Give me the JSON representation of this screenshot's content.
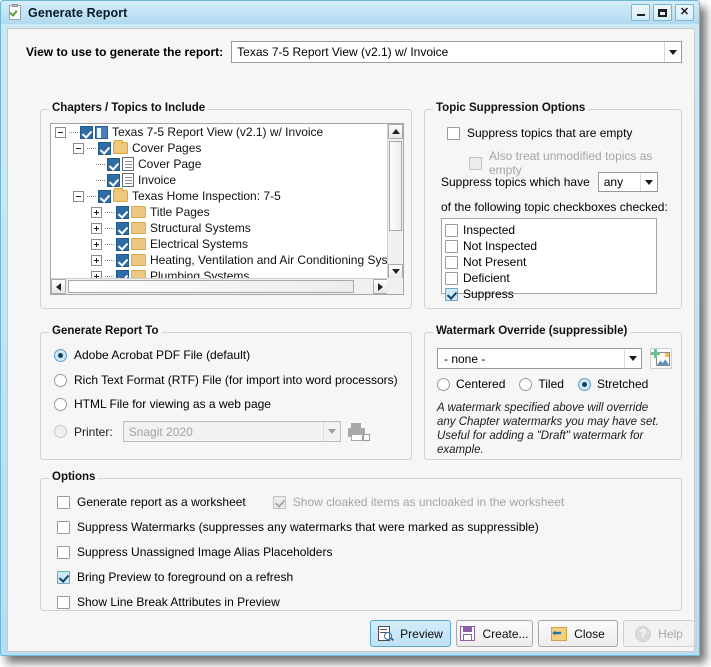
{
  "window": {
    "title": "Generate Report",
    "icon": "clipboard-check-icon",
    "minimize_label": "",
    "maximize_label": "",
    "close_label": "✕"
  },
  "view_row": {
    "label": "View to use to generate the report:",
    "value": "Texas 7-5 Report View (v2.1) w/ Invoice"
  },
  "chapters": {
    "title": "Chapters / Topics to Include",
    "tree": [
      {
        "label": "Texas 7-5 Report View (v2.1) w/ Invoice",
        "depth": 0,
        "expander": "minus",
        "icon": "view-icon",
        "checked": true
      },
      {
        "label": "Cover Pages",
        "depth": 1,
        "expander": "minus",
        "icon": "folder-open-icon",
        "checked": true
      },
      {
        "label": "Cover Page",
        "depth": 2,
        "expander": "none",
        "icon": "document-icon",
        "checked": true
      },
      {
        "label": "Invoice",
        "depth": 2,
        "expander": "none",
        "icon": "document-icon",
        "checked": true
      },
      {
        "label": "Texas Home Inspection: 7-5",
        "depth": 1,
        "expander": "minus",
        "icon": "folder-open-icon",
        "checked": true
      },
      {
        "label": "Title Pages",
        "depth": 2,
        "expander": "plus",
        "icon": "folder-icon",
        "checked": true
      },
      {
        "label": "Structural Systems",
        "depth": 2,
        "expander": "plus",
        "icon": "folder-icon",
        "checked": true
      },
      {
        "label": "Electrical Systems",
        "depth": 2,
        "expander": "plus",
        "icon": "folder-icon",
        "checked": true
      },
      {
        "label": "Heating, Ventilation and Air Conditioning Syste",
        "depth": 2,
        "expander": "plus",
        "icon": "folder-icon",
        "checked": true
      },
      {
        "label": "Plumbing Systems",
        "depth": 2,
        "expander": "plus",
        "icon": "folder-icon",
        "checked": true
      }
    ]
  },
  "suppression": {
    "title": "Topic Suppression Options",
    "suppress_empty_label": "Suppress topics that are empty",
    "suppress_empty_checked": false,
    "unmodified_label": "Also treat unmodified topics as empty",
    "unmodified_checked": false,
    "unmodified_disabled": true,
    "which_have_label": "Suppress topics which have",
    "which_have_value": "any",
    "following_label": "of the following topic checkboxes checked:",
    "checkbox_list": [
      {
        "label": "Inspected",
        "checked": false
      },
      {
        "label": "Not Inspected",
        "checked": false
      },
      {
        "label": "Not Present",
        "checked": false
      },
      {
        "label": "Deficient",
        "checked": false
      },
      {
        "label": "Suppress",
        "checked": true
      }
    ]
  },
  "generate_to": {
    "title": "Generate Report To",
    "options": [
      {
        "label": "Adobe Acrobat PDF File (default)",
        "selected": true
      },
      {
        "label": "Rich Text Format (RTF) File (for import into word processors)",
        "selected": false
      },
      {
        "label": "HTML File for viewing as a web page",
        "selected": false
      },
      {
        "label": "Printer:",
        "selected": false
      }
    ],
    "printer_value": "Snagit 2020"
  },
  "watermark": {
    "title": "Watermark Override (suppressible)",
    "combo_value": "- none -",
    "add_image_icon": "add-image-icon",
    "modes": [
      {
        "label": "Centered",
        "selected": false
      },
      {
        "label": "Tiled",
        "selected": false
      },
      {
        "label": "Stretched",
        "selected": true
      }
    ],
    "note": "A watermark specified above will override any Chapter watermarks you may have set.  Useful for adding a \"Draft\" watermark for example."
  },
  "options": {
    "title": "Options",
    "items": [
      {
        "label": "Generate report as a worksheet",
        "checked": false,
        "disabled": false
      },
      {
        "label": "Show cloaked items as uncloaked in the worksheet",
        "checked": true,
        "disabled": true
      },
      {
        "label": "Suppress Watermarks (suppresses any watermarks that were marked as suppressible)",
        "checked": false,
        "disabled": false
      },
      {
        "label": "Suppress Unassigned Image Alias Placeholders",
        "checked": false,
        "disabled": false
      },
      {
        "label": "Bring Preview to foreground on a refresh",
        "checked": true,
        "disabled": false
      },
      {
        "label": "Show Line Break Attributes in Preview",
        "checked": false,
        "disabled": false
      }
    ]
  },
  "buttons": {
    "preview": "Preview",
    "create": "Create...",
    "close": "Close",
    "help": "Help",
    "help_glyph": "?"
  },
  "colors": {
    "title_bar": "#c2e3f4",
    "frame": "#6fb8d8",
    "accent": "#2e6da4",
    "checkbox_checked_bg": "#cfe8f7",
    "folder": "#f2c879"
  }
}
